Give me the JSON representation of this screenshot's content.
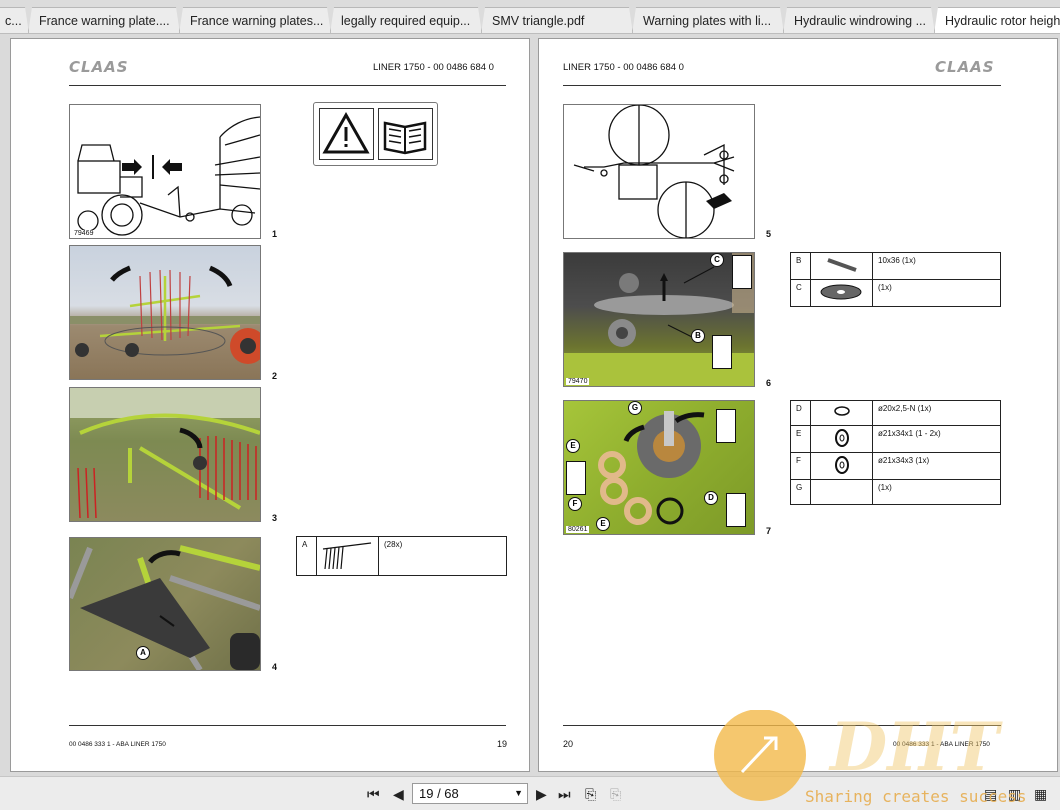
{
  "tabs": [
    {
      "label": "c..."
    },
    {
      "label": "France warning plate...."
    },
    {
      "label": "France warning plates..."
    },
    {
      "label": "legally required equip..."
    },
    {
      "label": "SMV triangle.pdf"
    },
    {
      "label": "Warning plates with li..."
    },
    {
      "label": "Hydraulic windrowing ..."
    },
    {
      "label": "Hydraulic rotor height"
    }
  ],
  "left_page": {
    "brand": "CLAAS",
    "title": "LINER 1750 - 00 0486 684 0",
    "figures": [
      {
        "number": "1",
        "code": "79469"
      },
      {
        "number": "2",
        "code": ""
      },
      {
        "number": "3",
        "code": ""
      },
      {
        "number": "4",
        "code": "",
        "callout": "A"
      }
    ],
    "parts": [
      {
        "key": "A",
        "desc": "(28x)"
      }
    ],
    "footer": "00 0486 333 1 - ABA LINER 1750",
    "page_number": "19"
  },
  "right_page": {
    "brand": "CLAAS",
    "title": "LINER 1750 - 00 0486 684 0",
    "figures": [
      {
        "number": "5",
        "code": ""
      },
      {
        "number": "6",
        "code": "79470",
        "callouts": [
          "C",
          "B"
        ]
      },
      {
        "number": "7",
        "code": "80261",
        "callouts": [
          "G",
          "E",
          "F",
          "E",
          "D"
        ]
      }
    ],
    "parts_a": [
      {
        "key": "B",
        "desc": "10x36 (1x)"
      },
      {
        "key": "C",
        "desc": "(1x)"
      }
    ],
    "parts_b": [
      {
        "key": "D",
        "desc": "ø20x2,5-N (1x)"
      },
      {
        "key": "E",
        "desc": "ø21x34x1 (1 - 2x)"
      },
      {
        "key": "F",
        "desc": "ø21x34x3 (1x)"
      },
      {
        "key": "G",
        "desc": "(1x)"
      }
    ],
    "footer": "00 0486 333 1 - ABA LINER 1750",
    "page_number": "20"
  },
  "toolbar": {
    "page_display": "19 / 68"
  },
  "watermark": {
    "logo": "DHT",
    "slogan": "Sharing creates success"
  },
  "colors": {
    "claas_green": "#b5d33a",
    "tab_active": "#ffffff",
    "watermark": "#e9a93b"
  }
}
